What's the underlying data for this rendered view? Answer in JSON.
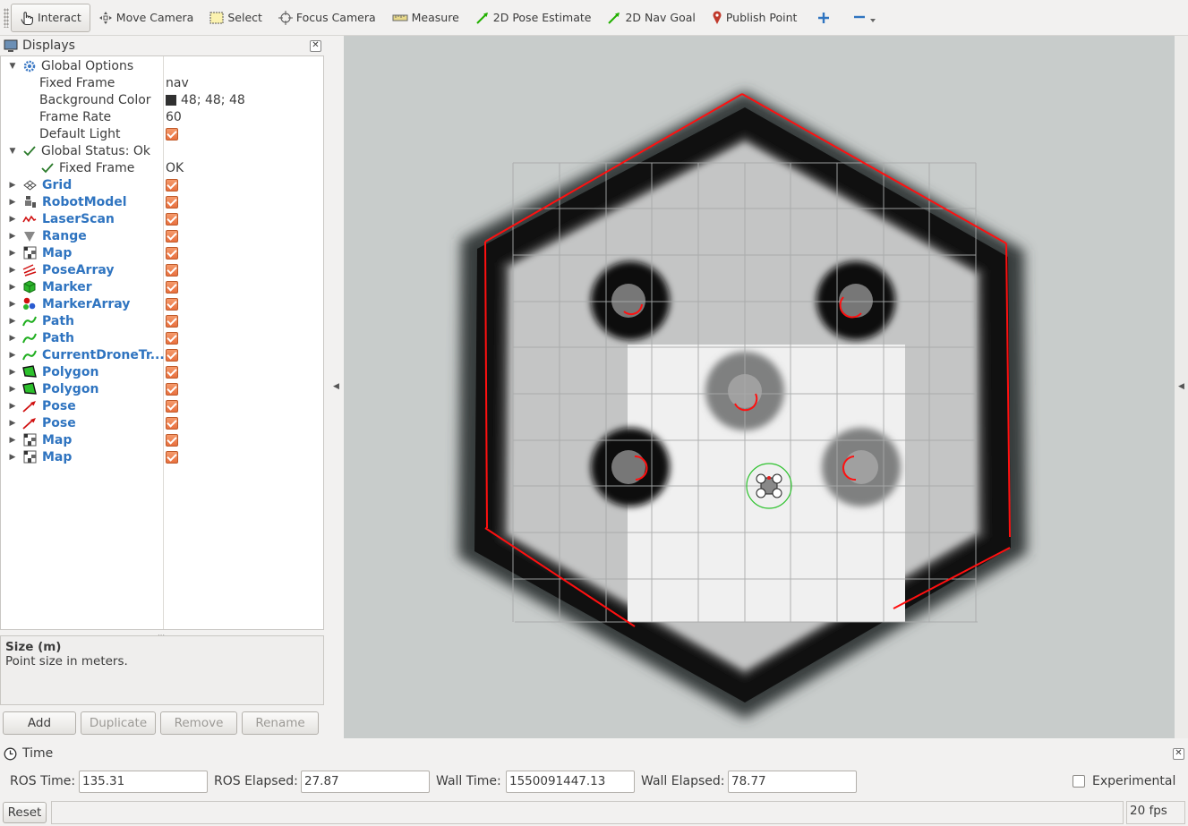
{
  "toolbar": {
    "tools": [
      {
        "label": "Interact",
        "icon": "hand-pointer-icon",
        "active": true
      },
      {
        "label": "Move Camera",
        "icon": "move-camera-icon"
      },
      {
        "label": "Select",
        "icon": "select-box-icon"
      },
      {
        "label": "Focus Camera",
        "icon": "focus-crosshair-icon"
      },
      {
        "label": "Measure",
        "icon": "ruler-icon"
      },
      {
        "label": "2D Pose Estimate",
        "icon": "green-arrow-icon"
      },
      {
        "label": "2D Nav Goal",
        "icon": "green-arrow-icon"
      },
      {
        "label": "Publish Point",
        "icon": "map-pin-icon"
      }
    ],
    "colors": {
      "accent_blue": "#2f74c0",
      "pose_green": "#22b000",
      "pin_red": "#c0392b"
    }
  },
  "displays": {
    "title": "Displays",
    "global_options": {
      "label": "Global Options",
      "fixed_frame_label": "Fixed Frame",
      "fixed_frame_value": "nav",
      "bg_color_label": "Background Color",
      "bg_color_value": "48; 48; 48",
      "frame_rate_label": "Frame Rate",
      "frame_rate_value": "60",
      "default_light_label": "Default Light"
    },
    "global_status": {
      "label": "Global Status: Ok",
      "fixed_frame_label": "Fixed Frame",
      "fixed_frame_value": "OK"
    },
    "items": [
      {
        "label": "Grid",
        "icon": "grid-icon"
      },
      {
        "label": "RobotModel",
        "icon": "robot-model-icon"
      },
      {
        "label": "LaserScan",
        "icon": "laser-scan-icon"
      },
      {
        "label": "Range",
        "icon": "range-cone-icon"
      },
      {
        "label": "Map",
        "icon": "map-icon"
      },
      {
        "label": "PoseArray",
        "icon": "pose-array-icon"
      },
      {
        "label": "Marker",
        "icon": "marker-cube-icon"
      },
      {
        "label": "MarkerArray",
        "icon": "marker-array-icon"
      },
      {
        "label": "Path",
        "icon": "path-icon"
      },
      {
        "label": "Path",
        "icon": "path-icon"
      },
      {
        "label": "CurrentDroneTr...",
        "icon": "path-icon"
      },
      {
        "label": "Polygon",
        "icon": "polygon-icon"
      },
      {
        "label": "Polygon",
        "icon": "polygon-icon"
      },
      {
        "label": "Pose",
        "icon": "pose-arrow-icon"
      },
      {
        "label": "Pose",
        "icon": "pose-arrow-icon"
      },
      {
        "label": "Map",
        "icon": "map-icon"
      },
      {
        "label": "Map",
        "icon": "map-icon"
      }
    ],
    "description": {
      "title": "Size (m)",
      "text": "Point size in meters."
    },
    "buttons": {
      "add": "Add",
      "duplicate": "Duplicate",
      "remove": "Remove",
      "rename": "Rename"
    }
  },
  "time": {
    "title": "Time",
    "ros_time_label": "ROS Time:",
    "ros_time": "135.31",
    "ros_elapsed_label": "ROS Elapsed:",
    "ros_elapsed": "27.87",
    "wall_time_label": "Wall Time:",
    "wall_time": "1550091447.13",
    "wall_elapsed_label": "Wall Elapsed:",
    "wall_elapsed": "78.77",
    "experimental_label": "Experimental"
  },
  "status": {
    "reset": "Reset",
    "fps": "20 fps"
  }
}
